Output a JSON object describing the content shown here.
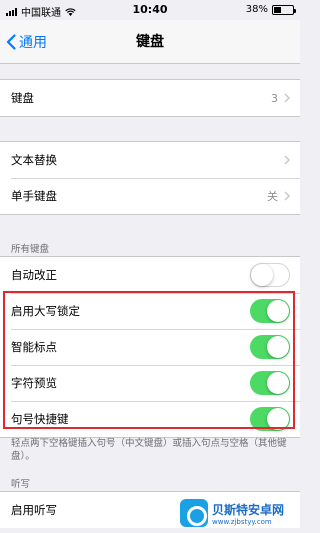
{
  "status_bar": {
    "carrier": "中国联通",
    "time": "10:40",
    "battery_percent": "38%",
    "battery_level": 0.38
  },
  "nav": {
    "back_label": "通用",
    "title": "键盘"
  },
  "group1": {
    "rows": [
      {
        "label": "键盘",
        "value": "3"
      }
    ]
  },
  "group2": {
    "rows": [
      {
        "label": "文本替换",
        "value": ""
      },
      {
        "label": "单手键盘",
        "value": "关"
      }
    ]
  },
  "all_keyboards": {
    "header": "所有键盘",
    "rows": [
      {
        "label": "自动改正",
        "on": false
      },
      {
        "label": "启用大写锁定",
        "on": true
      },
      {
        "label": "智能标点",
        "on": true
      },
      {
        "label": "字符预览",
        "on": true
      },
      {
        "label": "句号快捷键",
        "on": true
      }
    ],
    "footer": "轻点两下空格键插入句号（中文键盘）或插入句点与空格（其他键盘）。"
  },
  "dictation": {
    "header": "听写",
    "rows": [
      {
        "label": "启用听写"
      }
    ]
  },
  "colors": {
    "accent": "#007aff",
    "toggle_on": "#4cd964",
    "highlight_border": "#e0282e"
  },
  "watermark": {
    "title": "贝斯特安卓网",
    "url": "www.zjbstyy.com"
  }
}
